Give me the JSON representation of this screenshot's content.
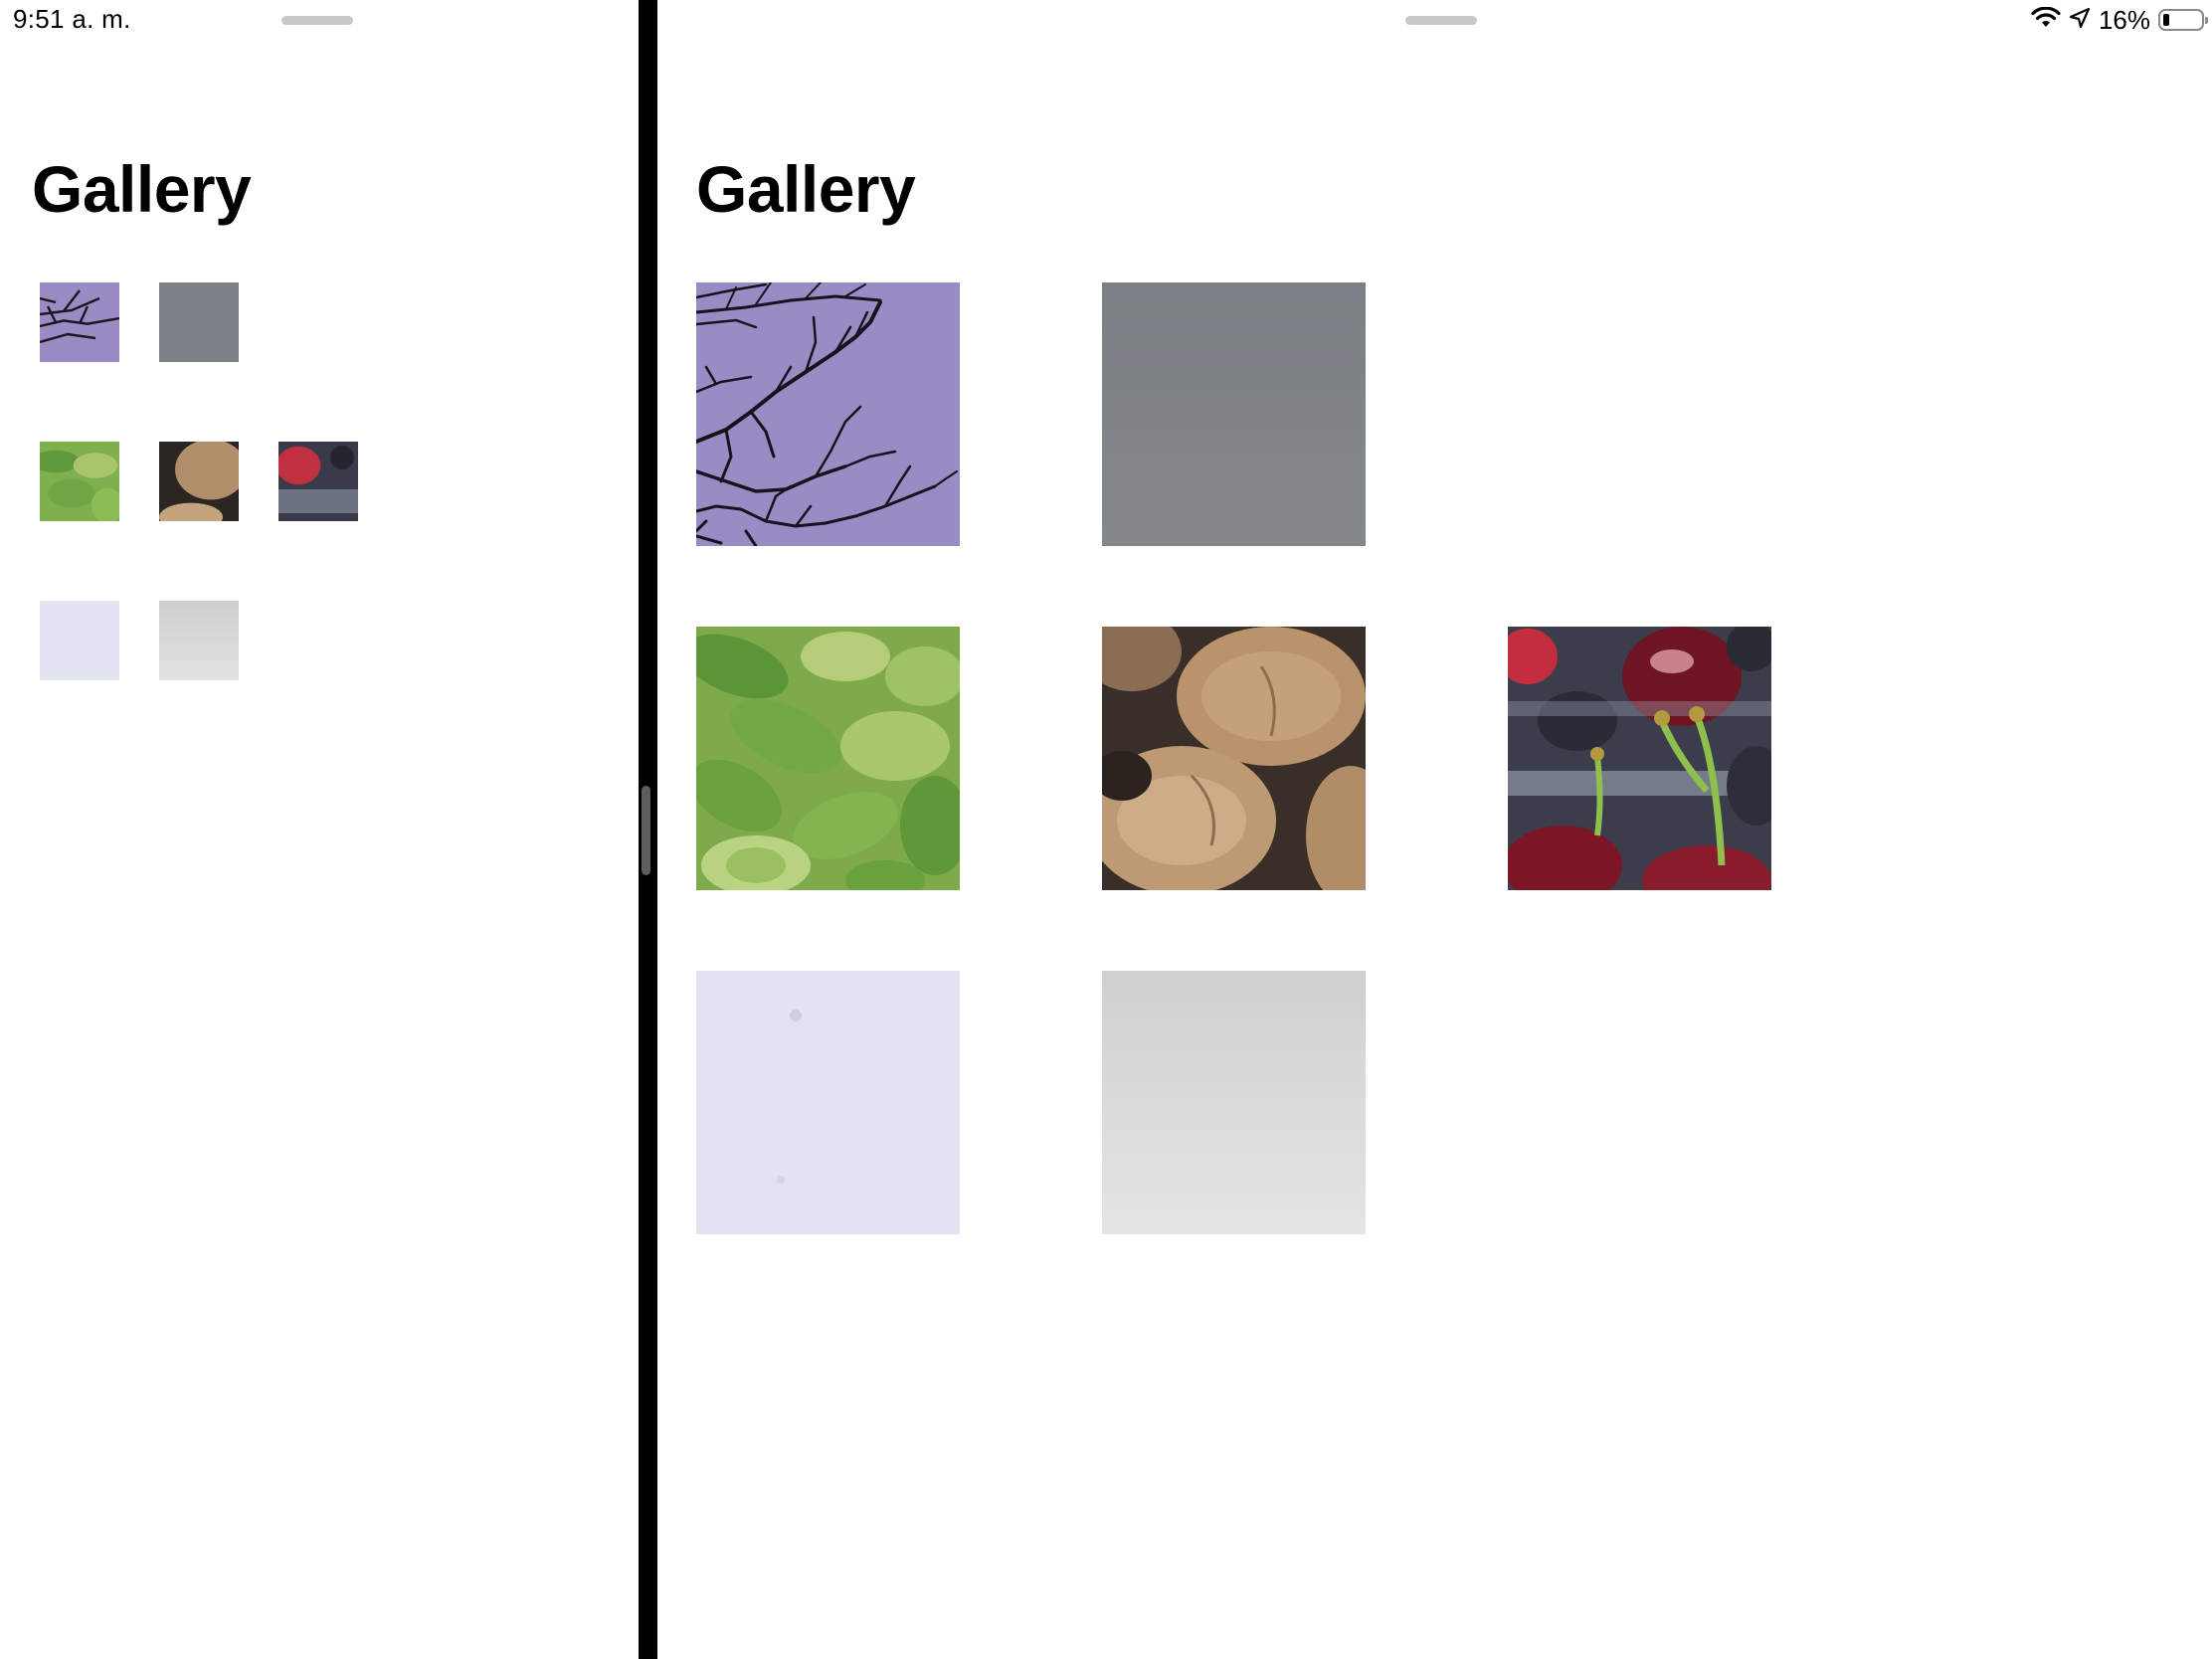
{
  "status_bar": {
    "time": "9:51 a. m.",
    "battery_percent": "16%",
    "battery_level": 0.16
  },
  "left_pane": {
    "title": "Gallery"
  },
  "right_pane": {
    "title": "Gallery"
  },
  "gallery": {
    "rows": [
      [
        "branches-photo",
        "gray-photo"
      ],
      [
        "green-vegetables-photo",
        "walnuts-photo",
        "cherries-photo"
      ],
      [
        "pale-lavender-photo",
        "light-gray-photo"
      ]
    ]
  },
  "colors": {
    "background": "#ffffff",
    "divider": "#000000",
    "title": "#000000"
  }
}
